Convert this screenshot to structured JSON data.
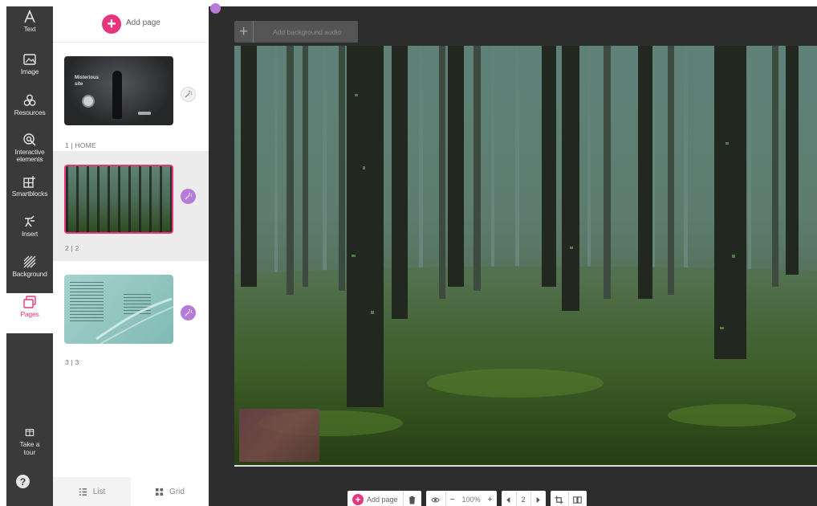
{
  "toolbar": {
    "items": [
      {
        "label": "Text",
        "icon": "text-icon"
      },
      {
        "label": "Image",
        "icon": "image-icon"
      },
      {
        "label": "Resources",
        "icon": "resources-icon"
      },
      {
        "label": "Interactive elements",
        "icon": "interactive-icon"
      },
      {
        "label": "Smartblocks",
        "icon": "smartblocks-icon"
      },
      {
        "label": "Insert",
        "icon": "insert-icon"
      },
      {
        "label": "Background",
        "icon": "background-icon"
      },
      {
        "label": "Pages",
        "icon": "pages-icon"
      }
    ],
    "active": "Pages",
    "tour_label": "Take a tour",
    "help_label": "?"
  },
  "pages_panel": {
    "add_page_label": "Add page",
    "thumb_title": "Misterious\nsite",
    "pages": [
      {
        "caption": "1 | HOME",
        "selected": false
      },
      {
        "caption": "2 | 2",
        "selected": true
      },
      {
        "caption": "3 | 3",
        "selected": false
      }
    ],
    "view_list_label": "List",
    "view_grid_label": "Grid"
  },
  "editor": {
    "audio_placeholder": "Add background audio"
  },
  "bottom_bar": {
    "add_page_label": "Add page",
    "zoom": "100%",
    "current_page": "2"
  },
  "colors": {
    "accent": "#e8367e",
    "magic": "#b87ad9",
    "sidebar": "#3a3a3a",
    "editor_bg": "#2d2d2d"
  }
}
